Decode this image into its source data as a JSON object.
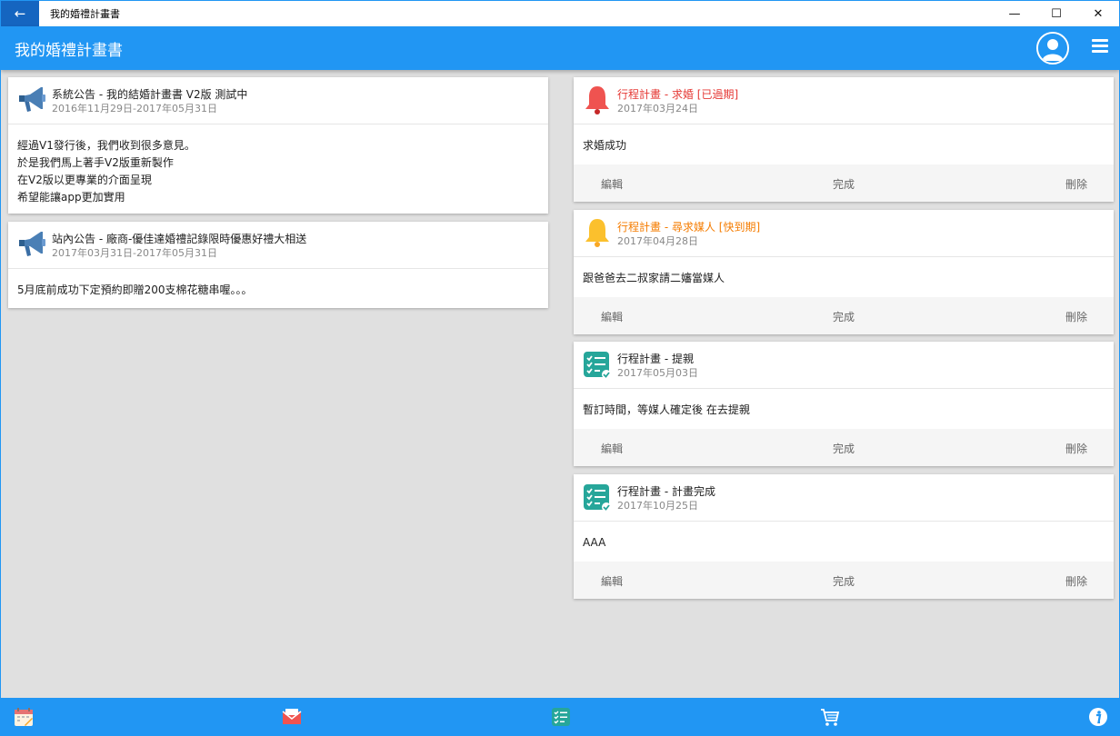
{
  "window": {
    "title": "我的婚禮計畫書",
    "back_glyph": "←",
    "minimize_glyph": "—",
    "maximize_glyph": "☐",
    "close_glyph": "✕"
  },
  "appbar": {
    "title": "我的婚禮計畫書",
    "avatar_icon": "user-avatar-icon",
    "menu_icon": "hamburger-menu-icon"
  },
  "announcements": [
    {
      "title": "系統公告 - 我的結婚計畫書 V2版 測試中",
      "date": "2016年11月29日-2017年05月31日",
      "lines": [
        "經過V1發行後，我們收到很多意見。",
        "於是我們馬上著手V2版重新製作",
        "在V2版以更專業的介面呈現",
        "希望能讓app更加實用"
      ],
      "icon": "megaphone-icon"
    },
    {
      "title": "站內公告 - 廠商-優佳達婚禮記錄限時優惠好禮大相送",
      "date": "2017年03月31日-2017年05月31日",
      "lines": [
        "5月底前成功下定預約即贈200支棉花糖串喔。。。"
      ],
      "icon": "megaphone-icon"
    }
  ],
  "schedule": [
    {
      "title": "行程計畫 - 求婚 [已過期]",
      "date": "2017年03月24日",
      "body": "求婚成功",
      "status_color": "#e53935",
      "icon": "red-bell-icon"
    },
    {
      "title": "行程計畫 - 尋求媒人 [快到期]",
      "date": "2017年04月28日",
      "body": "跟爸爸去二叔家請二嬸當媒人",
      "status_color": "#f57c00",
      "icon": "yellow-bell-icon"
    },
    {
      "title": "行程計畫 - 提親",
      "date": "2017年05月03日",
      "body": "暫訂時間，等媒人確定後 在去提親",
      "status_color": "#212121",
      "icon": "checklist-icon"
    },
    {
      "title": "行程計畫 - 計畫完成",
      "date": "2017年10月25日",
      "body": "AAA",
      "status_color": "#212121",
      "icon": "checklist-icon"
    }
  ],
  "actions": {
    "edit": "編輯",
    "done": "完成",
    "delete": "刪除"
  },
  "bottombar": {
    "icons": [
      "calendar-icon",
      "mail-icon",
      "checklist-icon",
      "shopping-cart-icon",
      "info-icon"
    ]
  }
}
